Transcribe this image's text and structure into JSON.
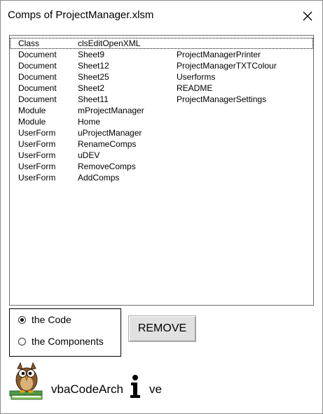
{
  "window": {
    "title": "Comps of ProjectManager.xlsm"
  },
  "components": [
    {
      "type": "Class",
      "name": "clsEditOpenXML",
      "doc_name": "",
      "selected": true
    },
    {
      "type": "Document",
      "name": "Sheet9",
      "doc_name": "ProjectManagerPrinter",
      "selected": false
    },
    {
      "type": "Document",
      "name": "Sheet12",
      "doc_name": "ProjectManagerTXTColour",
      "selected": false
    },
    {
      "type": "Document",
      "name": "Sheet25",
      "doc_name": "Userforms",
      "selected": false
    },
    {
      "type": "Document",
      "name": "Sheet2",
      "doc_name": "README",
      "selected": false
    },
    {
      "type": "Document",
      "name": "Sheet11",
      "doc_name": "ProjectManagerSettings",
      "selected": false
    },
    {
      "type": "Module",
      "name": "mProjectManager",
      "doc_name": "",
      "selected": false
    },
    {
      "type": "Module",
      "name": "Home",
      "doc_name": "",
      "selected": false
    },
    {
      "type": "UserForm",
      "name": "uProjectManager",
      "doc_name": "",
      "selected": false
    },
    {
      "type": "UserForm",
      "name": "RenameComps",
      "doc_name": "",
      "selected": false
    },
    {
      "type": "UserForm",
      "name": "uDEV",
      "doc_name": "",
      "selected": false
    },
    {
      "type": "UserForm",
      "name": "RemoveComps",
      "doc_name": "",
      "selected": false
    },
    {
      "type": "UserForm",
      "name": "AddComps",
      "doc_name": "",
      "selected": false
    }
  ],
  "options": {
    "code_label": "the Code",
    "components_label": "the Components",
    "selected": "code"
  },
  "actions": {
    "remove_label": "REMOVE"
  },
  "branding": {
    "text_before": "vbaCodeArch",
    "text_after": "ve",
    "icons": [
      "owl-logo-icon",
      "info-i-icon"
    ]
  }
}
